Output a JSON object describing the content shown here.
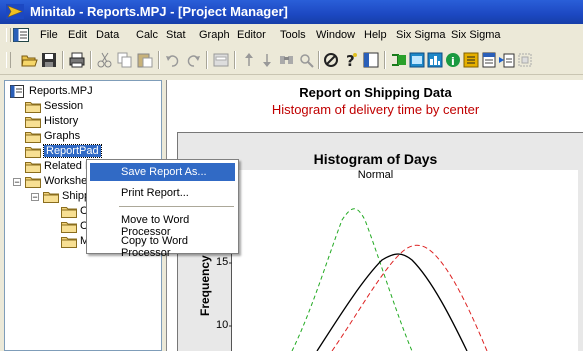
{
  "window": {
    "title": "Minitab - Reports.MPJ - [Project Manager]"
  },
  "menubar": {
    "items": [
      "File",
      "Edit",
      "Data",
      "Calc",
      "Stat",
      "Graph",
      "Editor",
      "Tools",
      "Window",
      "Help",
      "Six Sigma",
      "Six Sigma"
    ]
  },
  "toolbar": {
    "buttons": [
      "open-icon",
      "save-icon",
      "print-icon",
      "cut-icon",
      "copy-icon",
      "paste-icon",
      "undo-icon",
      "redo-icon",
      "edit-last-dialog-icon",
      "up-icon",
      "down-icon",
      "find-icon",
      "find-next-icon",
      "cancel-icon",
      "help-icon",
      "project-manager-icon",
      "show-session-icon",
      "show-worksheets-icon",
      "show-graphs-icon",
      "show-info-icon",
      "show-history-icon",
      "report-pad-icon",
      "related-documents-icon",
      "design-icon"
    ]
  },
  "tree": {
    "items": [
      {
        "label": "Reports.MPJ"
      },
      {
        "label": "Session"
      },
      {
        "label": "History"
      },
      {
        "label": "Graphs"
      },
      {
        "label": "ReportPad"
      },
      {
        "label": "Related D"
      },
      {
        "label": "Workshee"
      },
      {
        "label": "Shippi"
      },
      {
        "label": "Co"
      },
      {
        "label": "Co"
      },
      {
        "label": "M"
      }
    ]
  },
  "context_menu": {
    "items": [
      {
        "label": "Save Report As...",
        "highlighted": true
      },
      {
        "label": "Print Report..."
      },
      {
        "label": "Move to Word Processor"
      },
      {
        "label": "Copy to Word Processor"
      }
    ]
  },
  "report": {
    "title": "Report on Shipping Data",
    "subtitle": "Histogram of delivery time by center"
  },
  "graph": {
    "title": "Histogram of Days",
    "subtitle": "Normal",
    "ylabel": "Frequency",
    "yticks": [
      "15",
      "10"
    ]
  },
  "chart_data": {
    "type": "line",
    "title": "Histogram of Days",
    "subtitle": "Normal",
    "ylabel": "Frequency",
    "yticks": [
      15,
      10
    ],
    "series": [
      {
        "style": "dashed",
        "color": "#22aa22"
      },
      {
        "style": "solid",
        "color": "#000000"
      },
      {
        "style": "dashed",
        "color": "#dd2222"
      }
    ]
  },
  "colors": {
    "titlebar": "#1c48c2",
    "highlight": "#316ac5",
    "subtitle_red": "#c00000"
  }
}
